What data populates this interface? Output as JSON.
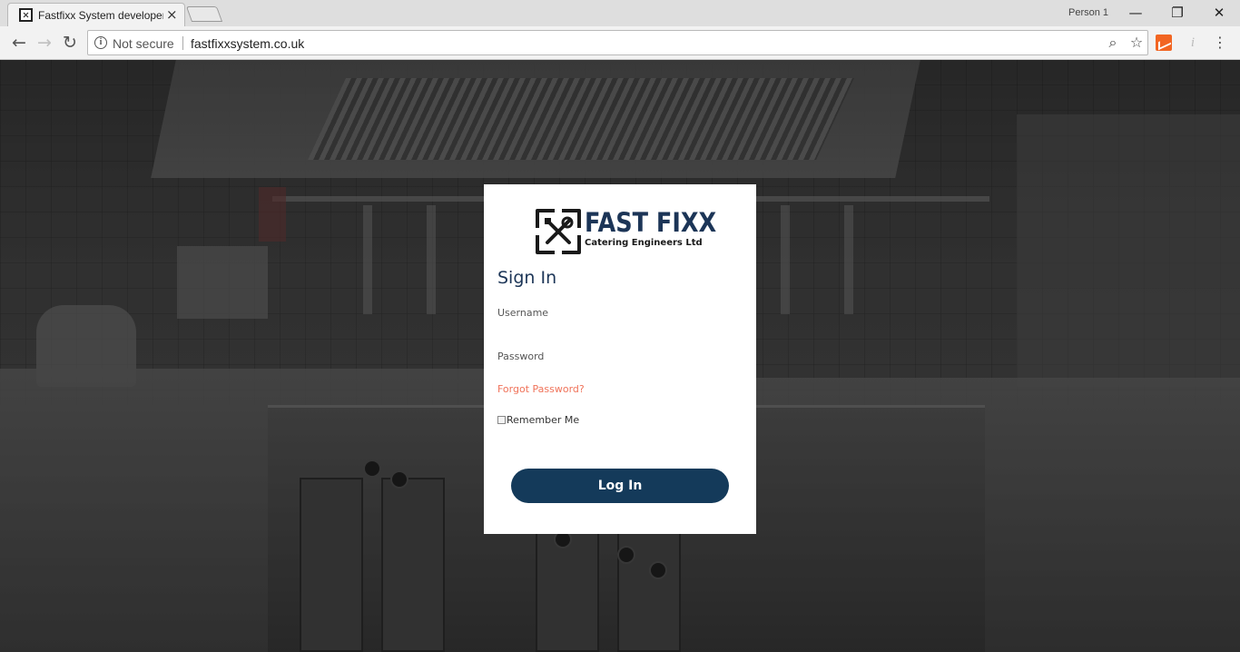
{
  "browser": {
    "tab_title": "Fastfixx System developer",
    "tab_close": "×",
    "profile": "Person 1",
    "window_minimize": "—",
    "window_restore": "❐",
    "window_close": "✕",
    "nav_back": "←",
    "nav_forward": "→",
    "nav_reload": "↻",
    "security_label": "Not secure",
    "url": "fastfixxsystem.co.uk",
    "zoom_glyph": "⌕",
    "bookmark_glyph": "☆",
    "ext_info_glyph": "i",
    "menu_glyph": "⋮"
  },
  "login": {
    "logo_title": "FAST FIXX",
    "logo_subtitle": "Catering Engineers Ltd",
    "heading": "Sign In",
    "username_label": "Username",
    "username_value": "",
    "password_label": "Password",
    "password_value": "",
    "forgot_link": "Forgot Password?",
    "remember_label": "Remember Me",
    "remember_checked": false,
    "submit_label": "Log In"
  },
  "colors": {
    "brand_navy": "#143a5a",
    "link_coral": "#f0735a",
    "card_bg": "#ffffff"
  }
}
